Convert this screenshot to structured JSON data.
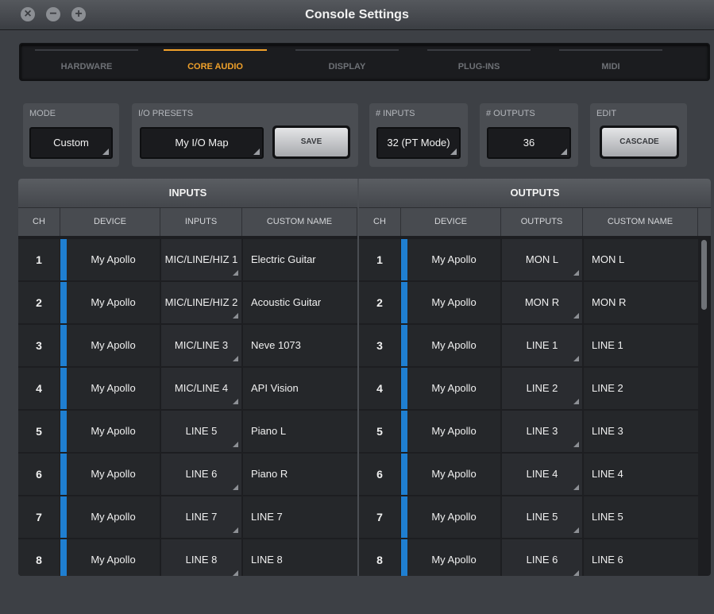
{
  "window": {
    "title": "Console Settings"
  },
  "tabs": [
    "HARDWARE",
    "CORE AUDIO",
    "DISPLAY",
    "PLUG-INS",
    "MIDI"
  ],
  "active_tab": "CORE AUDIO",
  "controls": {
    "mode": {
      "label": "MODE",
      "value": "Custom"
    },
    "io_presets": {
      "label": "I/O PRESETS",
      "value": "My I/O Map",
      "save_label": "SAVE"
    },
    "inputs": {
      "label": "# INPUTS",
      "value": "32 (PT Mode)"
    },
    "outputs": {
      "label": "# OUTPUTS",
      "value": "36"
    },
    "edit": {
      "label": "EDIT",
      "cascade_label": "CASCADE"
    }
  },
  "table": {
    "inputs_title": "INPUTS",
    "outputs_title": "OUTPUTS",
    "input_columns": [
      "CH",
      "DEVICE",
      "INPUTS",
      "CUSTOM NAME"
    ],
    "output_columns": [
      "CH",
      "DEVICE",
      "OUTPUTS",
      "CUSTOM NAME"
    ],
    "inputs": [
      {
        "ch": "1",
        "device": "My Apollo",
        "input": "MIC/LINE/HIZ 1",
        "name": "Electric Guitar"
      },
      {
        "ch": "2",
        "device": "My Apollo",
        "input": "MIC/LINE/HIZ 2",
        "name": "Acoustic Guitar"
      },
      {
        "ch": "3",
        "device": "My Apollo",
        "input": "MIC/LINE 3",
        "name": "Neve 1073"
      },
      {
        "ch": "4",
        "device": "My Apollo",
        "input": "MIC/LINE 4",
        "name": "API Vision"
      },
      {
        "ch": "5",
        "device": "My Apollo",
        "input": "LINE 5",
        "name": "Piano L"
      },
      {
        "ch": "6",
        "device": "My Apollo",
        "input": "LINE 6",
        "name": "Piano R"
      },
      {
        "ch": "7",
        "device": "My Apollo",
        "input": "LINE 7",
        "name": "LINE 7"
      },
      {
        "ch": "8",
        "device": "My Apollo",
        "input": "LINE 8",
        "name": "LINE 8"
      }
    ],
    "outputs": [
      {
        "ch": "1",
        "device": "My Apollo",
        "output": "MON L",
        "name": "MON L"
      },
      {
        "ch": "2",
        "device": "My Apollo",
        "output": "MON R",
        "name": "MON R"
      },
      {
        "ch": "3",
        "device": "My Apollo",
        "output": "LINE 1",
        "name": "LINE 1"
      },
      {
        "ch": "4",
        "device": "My Apollo",
        "output": "LINE 2",
        "name": "LINE 2"
      },
      {
        "ch": "5",
        "device": "My Apollo",
        "output": "LINE 3",
        "name": "LINE 3"
      },
      {
        "ch": "6",
        "device": "My Apollo",
        "output": "LINE 4",
        "name": "LINE 4"
      },
      {
        "ch": "7",
        "device": "My Apollo",
        "output": "LINE 5",
        "name": "LINE 5"
      },
      {
        "ch": "8",
        "device": "My Apollo",
        "output": "LINE 6",
        "name": "LINE 6"
      }
    ]
  },
  "colors": {
    "accent": "#f0a12a",
    "device_bar": "#1f7fd1"
  }
}
